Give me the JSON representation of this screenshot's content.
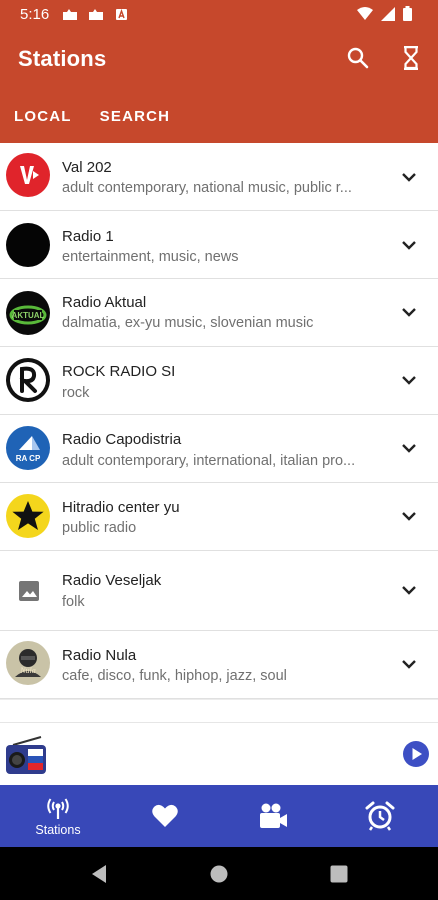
{
  "status_bar": {
    "time": "5:16"
  },
  "app_bar": {
    "title": "Stations",
    "search_icon": "search-icon",
    "timer_icon": "hourglass-icon",
    "tabs": [
      {
        "label": "LOCAL",
        "active": true
      },
      {
        "label": "SEARCH",
        "active": false
      }
    ]
  },
  "stations": [
    {
      "name": "Val 202",
      "tags": "adult contemporary, national music, public r...",
      "logo": "val202-logo"
    },
    {
      "name": "Radio 1",
      "tags": "entertainment, music, news",
      "logo": "radio1-logo"
    },
    {
      "name": "Radio Aktual",
      "tags": "dalmatia, ex-yu music, slovenian music",
      "logo": "radio-aktual-logo"
    },
    {
      "name": "ROCK RADIO SI",
      "tags": "rock",
      "logo": "rock-radio-logo"
    },
    {
      "name": "Radio Capodistria",
      "tags": "adult contemporary, international, italian pro...",
      "logo": "radio-capodistria-logo"
    },
    {
      "name": "Hitradio center yu",
      "tags": "public radio",
      "logo": "star-logo"
    },
    {
      "name": "Radio Veseljak",
      "tags": "folk",
      "logo": "image-placeholder-icon"
    },
    {
      "name": "Radio Nula",
      "tags": "cafe, disco, funk, hiphop, jazz, soul",
      "logo": "radio-nula-logo"
    }
  ],
  "player": {
    "radio_icon": "radio-slovenia-icon",
    "play_icon": "play-icon"
  },
  "bottom_nav": [
    {
      "label": "Stations",
      "icon": "broadcast-icon"
    },
    {
      "label": "",
      "icon": "heart-icon"
    },
    {
      "label": "",
      "icon": "video-camera-icon"
    },
    {
      "label": "",
      "icon": "alarm-clock-icon"
    }
  ],
  "colors": {
    "app_bar": "#c6482c",
    "bottom_nav": "#3848b8",
    "accent_blue": "#3d4fc4"
  }
}
